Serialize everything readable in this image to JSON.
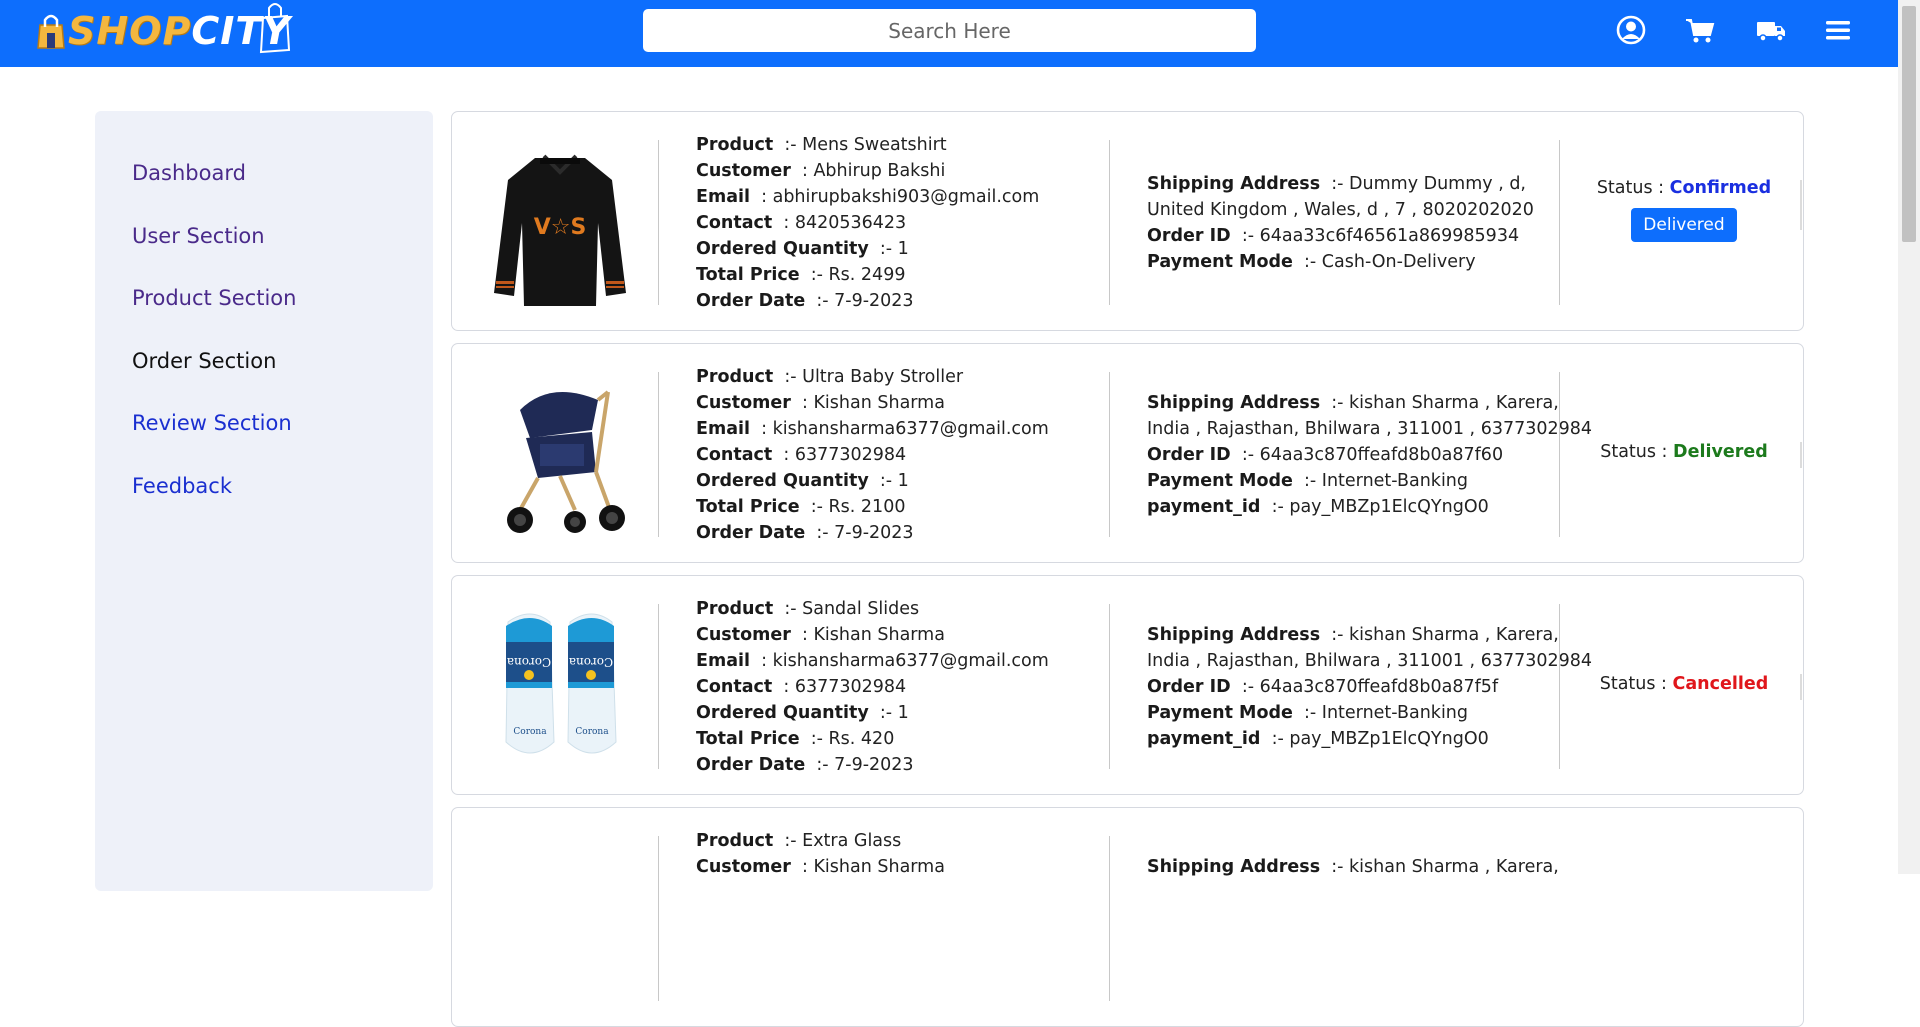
{
  "header": {
    "logo_shop": "SHOP",
    "logo_city": "CITY",
    "search_placeholder": "Search Here",
    "icons": [
      "user-circle-icon",
      "cart-icon",
      "truck-icon",
      "hamburger-menu-icon"
    ]
  },
  "sidebar": {
    "items": [
      {
        "label": "Dashboard",
        "color": "#4a2a8a"
      },
      {
        "label": "User Section",
        "color": "#4a2a8a"
      },
      {
        "label": "Product Section",
        "color": "#4a2a8a"
      },
      {
        "label": "Order Section",
        "color": "#111111"
      },
      {
        "label": "Review Section",
        "color": "#1a2fd0"
      },
      {
        "label": "Feedback",
        "color": "#1a2fd0"
      }
    ]
  },
  "labels": {
    "product": "Product",
    "customer": "Customer",
    "email": "Email",
    "contact": "Contact",
    "quantity": "Ordered Quantity",
    "price": "Total Price",
    "date": "Order Date",
    "shipping": "Shipping Address",
    "order_id": "Order ID",
    "payment_mode": "Payment Mode",
    "payment_id": "payment_id",
    "status": "Status :",
    "delivered_button": "Delivered"
  },
  "orders": [
    {
      "product": ":- Mens Sweatshirt",
      "customer": ": Abhirup Bakshi",
      "email": ": abhirupbakshi903@gmail.com",
      "contact": ": 8420536423",
      "quantity": ":- 1",
      "price": ":- Rs. 2499",
      "date": ":- 7-9-2023",
      "shipping_1": ":- Dummy Dummy , d,",
      "shipping_2": "United Kingdom , Wales, d , 7 , 8020202020",
      "order_id": ":- 64aa33c6f46561a869985934",
      "payment_mode": ":- Cash-On-Delivery",
      "status": "Confirmed"
    },
    {
      "product": ":- Ultra Baby Stroller",
      "customer": ": Kishan Sharma",
      "email": ": kishansharma6377@gmail.com",
      "contact": ": 6377302984",
      "quantity": ":- 1",
      "price": ":- Rs. 2100",
      "date": ":- 7-9-2023",
      "shipping_1": ":- kishan Sharma , Karera,",
      "shipping_2": "India , Rajasthan, Bhilwara , 311001 , 6377302984",
      "order_id": ":- 64aa3c870ffeafd8b0a87f60",
      "payment_mode": ":- Internet-Banking",
      "payment_id": ":- pay_MBZp1ElcQYngO0",
      "status": "Delivered"
    },
    {
      "product": ":- Sandal Slides",
      "customer": ": Kishan Sharma",
      "email": ": kishansharma6377@gmail.com",
      "contact": ": 6377302984",
      "quantity": ":- 1",
      "price": ":- Rs. 420",
      "date": ":- 7-9-2023",
      "shipping_1": ":- kishan Sharma , Karera,",
      "shipping_2": "India , Rajasthan, Bhilwara , 311001 , 6377302984",
      "order_id": ":- 64aa3c870ffeafd8b0a87f5f",
      "payment_mode": ":- Internet-Banking",
      "payment_id": ":- pay_MBZp1ElcQYngO0",
      "status": "Cancelled"
    },
    {
      "product": ":- Extra Glass",
      "customer": ": Kishan Sharma",
      "shipping_1": ":- kishan Sharma , Karera,"
    }
  ]
}
